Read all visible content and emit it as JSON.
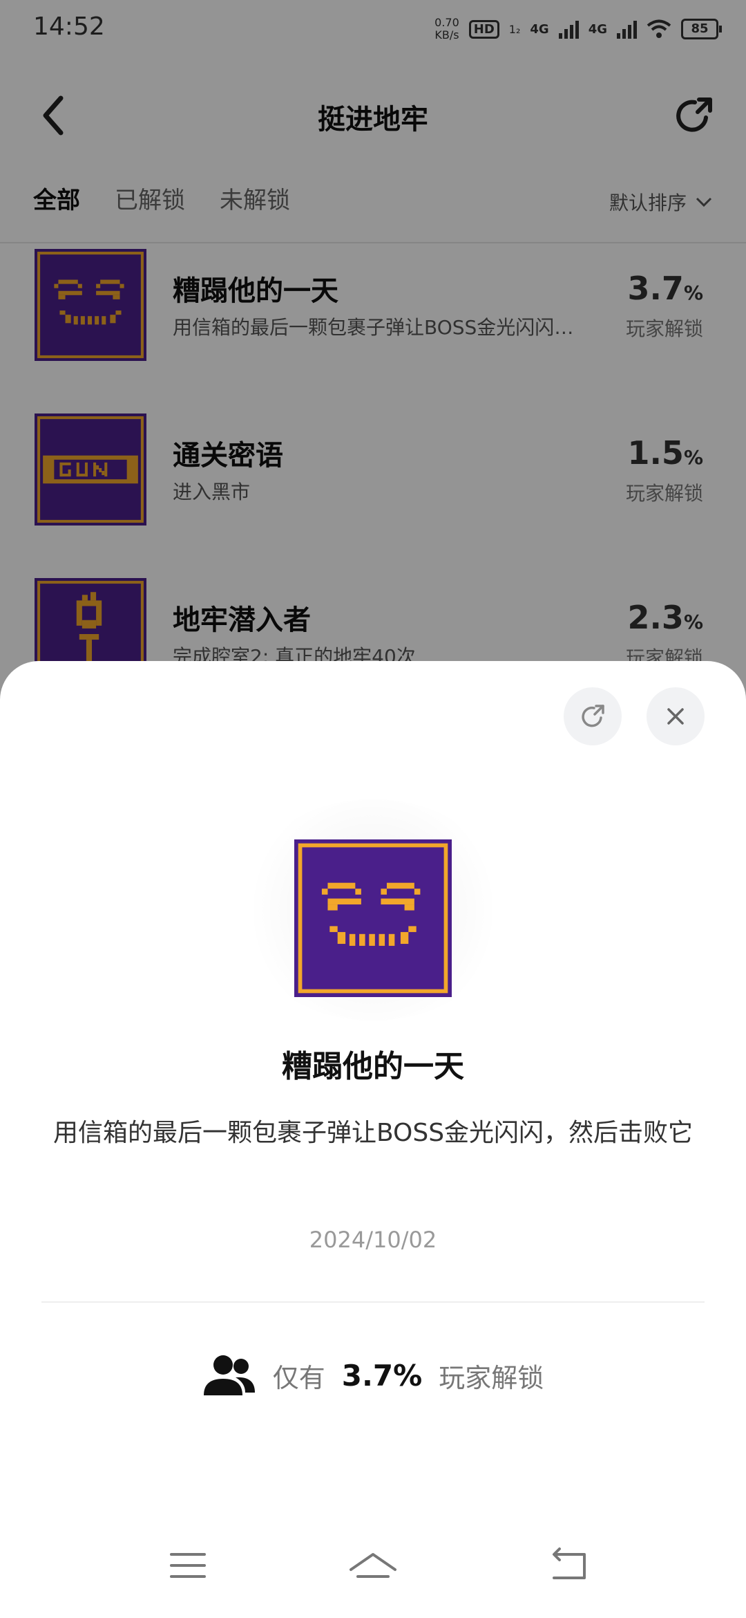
{
  "status": {
    "time": "14:52",
    "net_speed_value": "0.70",
    "net_speed_unit": "KB/s",
    "hd": "HD",
    "sim": "1₂",
    "net1": "4G",
    "net2": "4G",
    "battery": "85"
  },
  "header": {
    "title": "挺进地牢"
  },
  "tabs": [
    {
      "label": "全部",
      "active": true
    },
    {
      "label": "已解锁",
      "active": false
    },
    {
      "label": "未解锁",
      "active": false
    }
  ],
  "sort": {
    "label": "默认排序"
  },
  "achievements": [
    {
      "title": "糟蹋他的一天",
      "desc": "用信箱的最后一颗包裹子弹让BOSS金光闪闪，然后击败它",
      "percent": "3.7",
      "unit": "%",
      "label": "玩家解锁",
      "icon": "grin-face-icon"
    },
    {
      "title": "通关密语",
      "desc": "进入黑市",
      "percent": "1.5",
      "unit": "%",
      "label": "玩家解锁",
      "icon": "gun-sign-icon"
    },
    {
      "title": "地牢潜入者",
      "desc": "完成腔室2: 真正的地牢40次",
      "percent": "2.3",
      "unit": "%",
      "label": "玩家解锁",
      "icon": "torch-icon"
    }
  ],
  "detail": {
    "title": "糟蹋他的一天",
    "desc": "用信箱的最后一颗包裹子弹让BOSS金光闪闪，然后击败它",
    "date": "2024/10/02",
    "stat_prefix": "仅有",
    "stat_value": "3.7%",
    "stat_suffix": "玩家解锁"
  },
  "colors": {
    "badge_purple": "#4a1f8a",
    "badge_gold": "#f2a72b"
  }
}
